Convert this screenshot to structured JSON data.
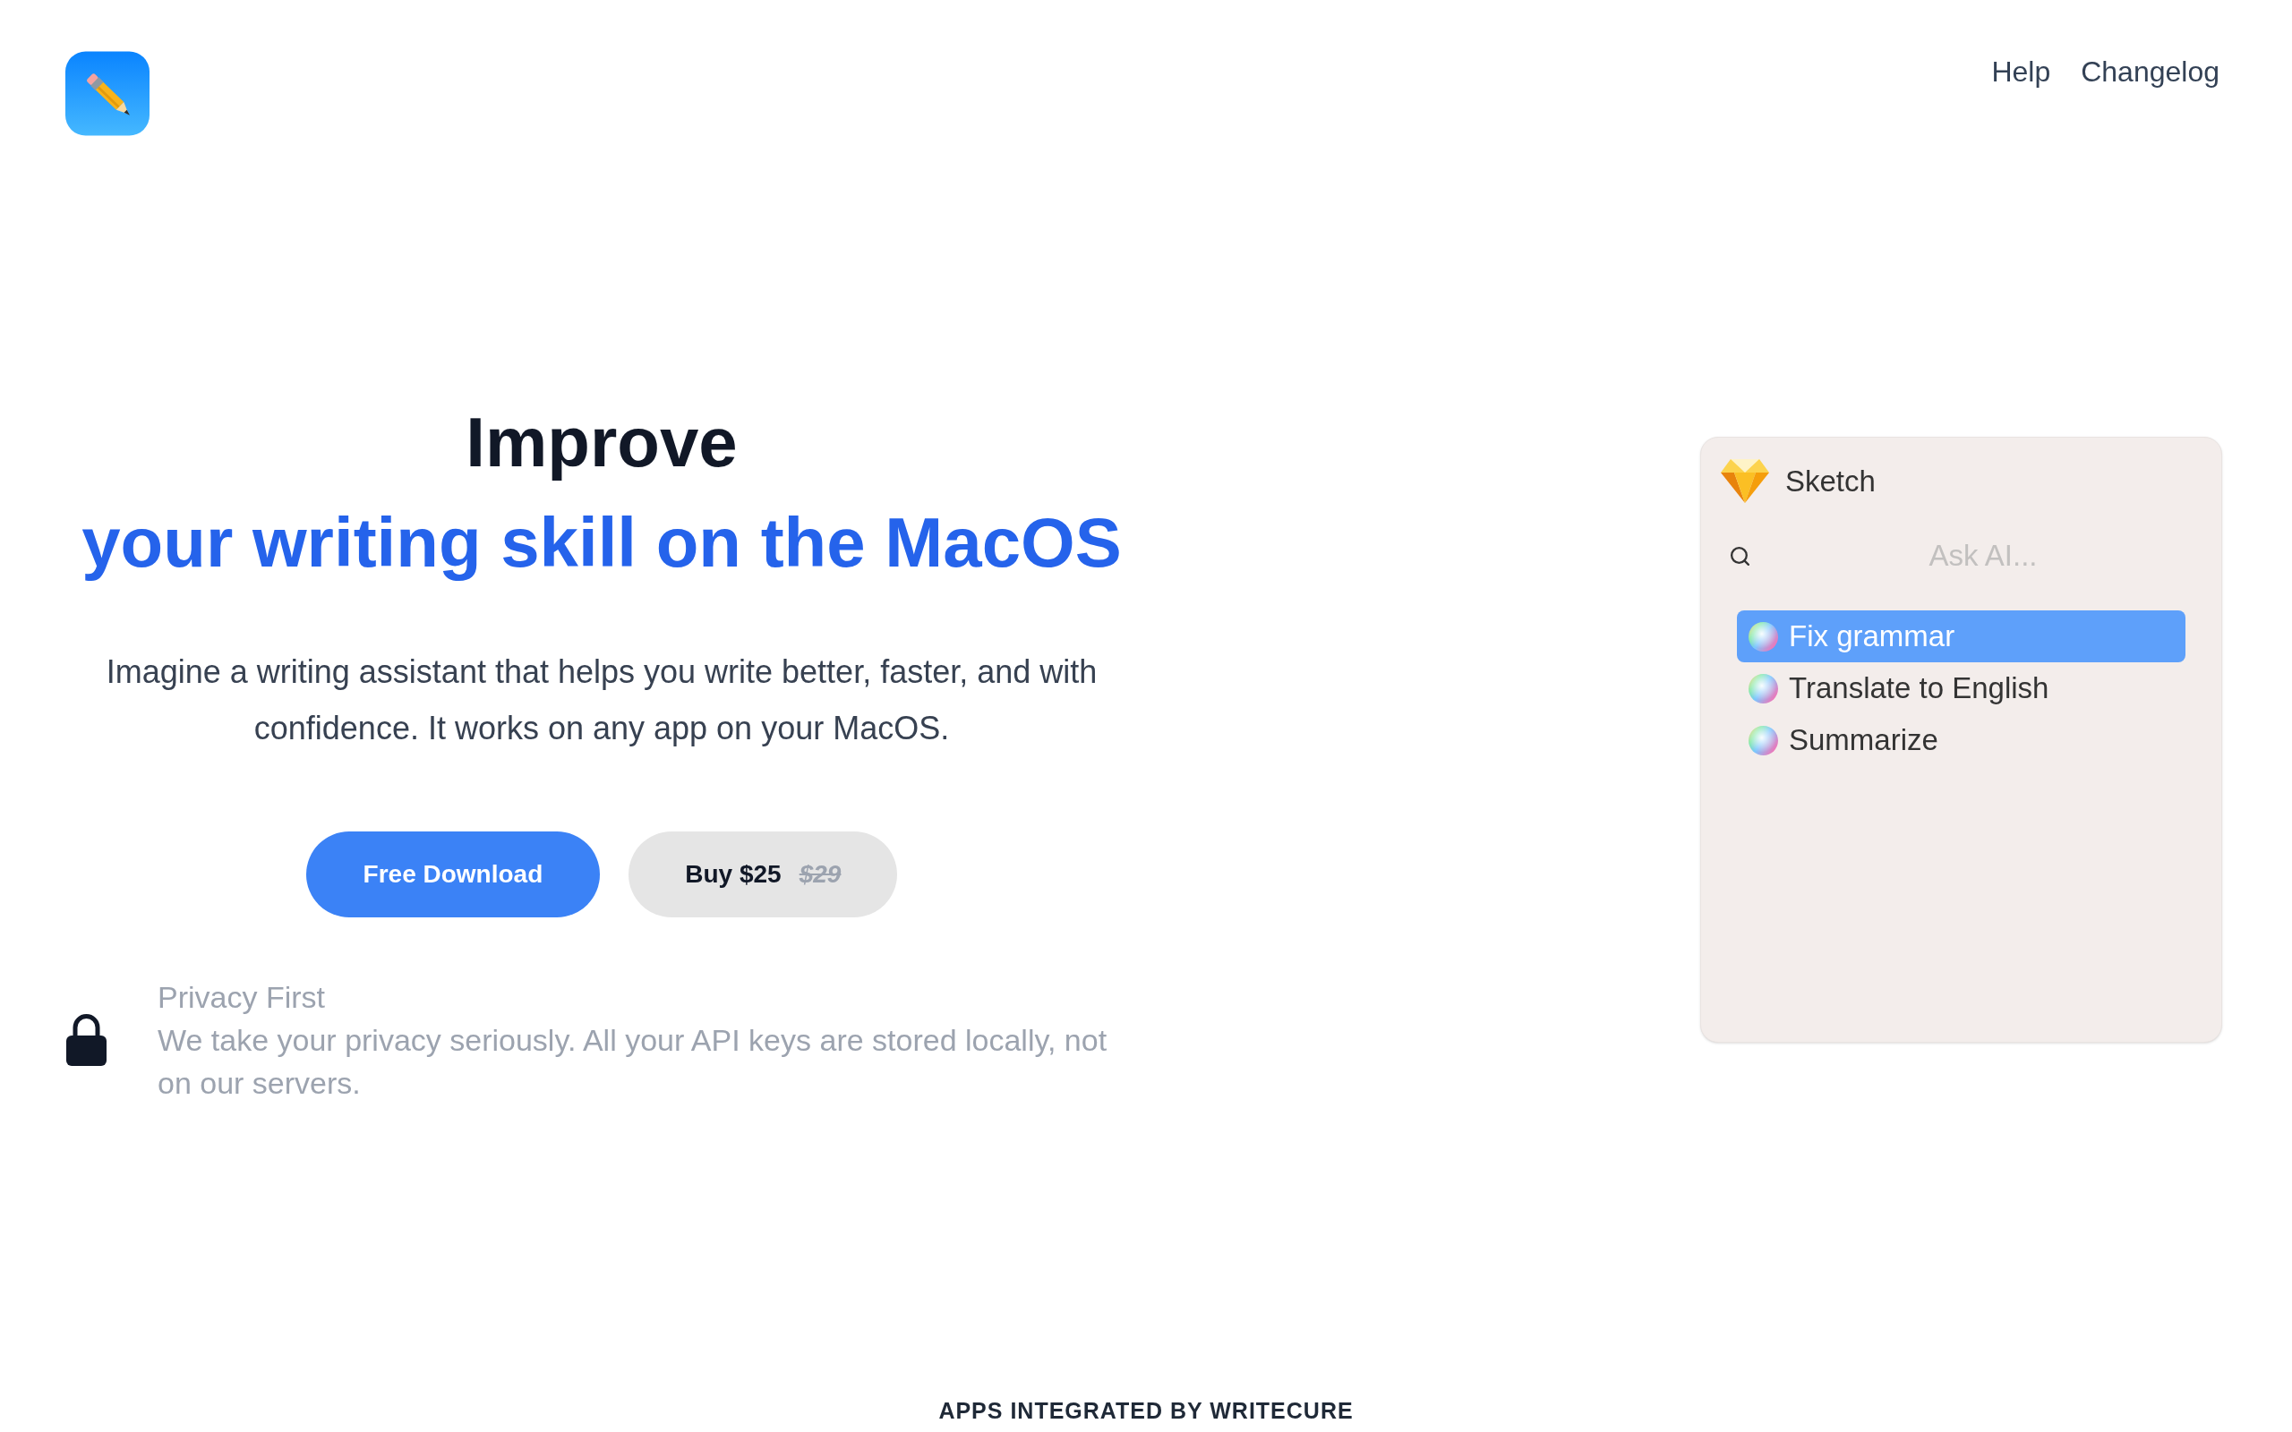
{
  "header": {
    "nav_links": [
      {
        "label": "Help"
      },
      {
        "label": "Changelog"
      }
    ]
  },
  "hero": {
    "title_lines": [
      {
        "text": "Improve",
        "accent": false
      },
      {
        "text": "your writing skill on the MacOS",
        "accent": true
      }
    ],
    "description": "Imagine a writing assistant that helps you write better, faster, and with confidence. It works on any app on your MacOS.",
    "buttons": [
      {
        "kind": "primary",
        "label": "Free Download"
      },
      {
        "kind": "secondary",
        "label": "Buy $25",
        "old_price": "$29"
      }
    ],
    "privacy": {
      "title": "Privacy First",
      "text": "We take your privacy seriously. All your API keys are stored locally, not on our servers."
    }
  },
  "preview_panel": {
    "app_name": "Sketch",
    "search": {
      "placeholder": "Ask AI..."
    },
    "items": [
      {
        "label": "Fix grammar",
        "selected": true
      },
      {
        "label": "Translate to English",
        "selected": false
      },
      {
        "label": "Summarize",
        "selected": false
      }
    ]
  },
  "section_title": "APPS INTEGRATED BY WRITECURE"
}
